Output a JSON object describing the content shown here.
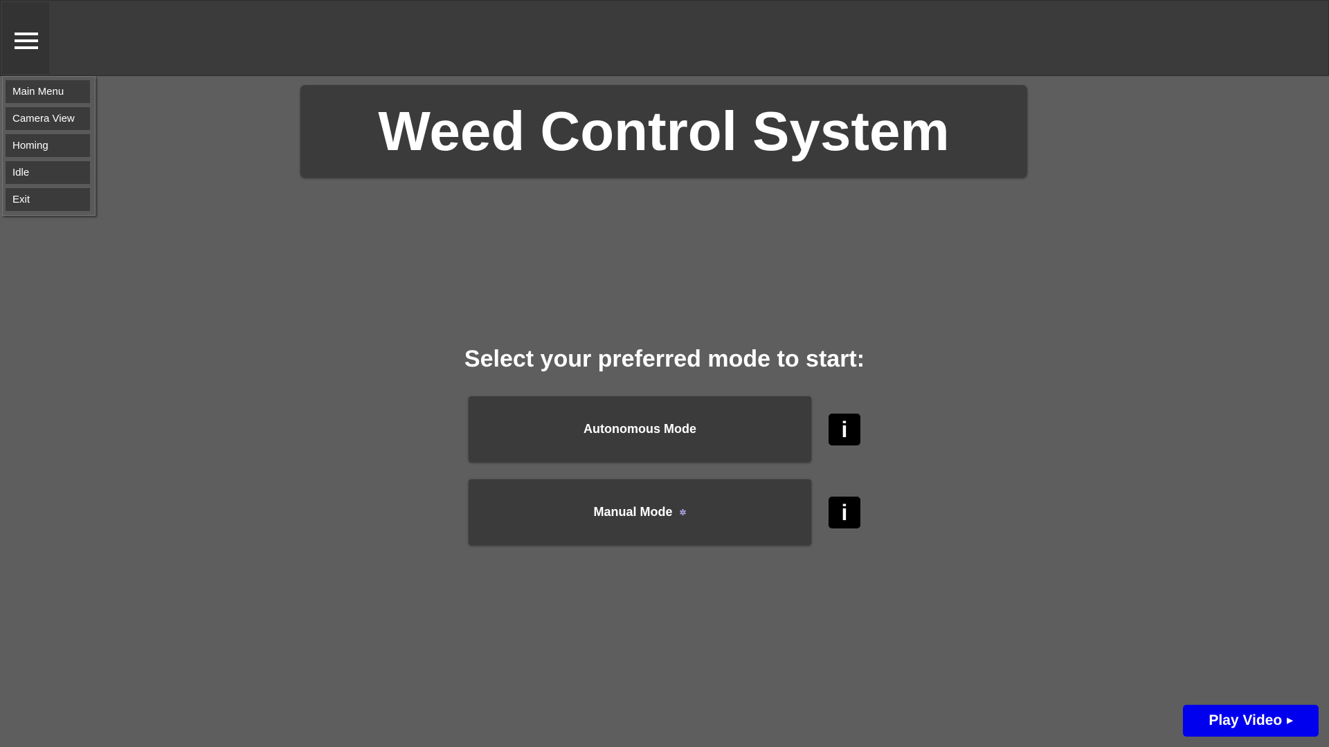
{
  "header": {
    "menu_icon": "hamburger-menu-icon"
  },
  "menu": {
    "items": [
      {
        "label": "Main Menu"
      },
      {
        "label": "Camera View"
      },
      {
        "label": "Homing"
      },
      {
        "label": "Idle"
      },
      {
        "label": "Exit"
      }
    ]
  },
  "main": {
    "title": "Weed Control System",
    "prompt": "Select your preferred mode to start:",
    "modes": [
      {
        "label": "Autonomous Mode",
        "info_label": "i"
      },
      {
        "label": "Manual Mode",
        "info_label": "i",
        "icon": "sparkle-icon"
      }
    ]
  },
  "video": {
    "label": "Play Video",
    "icon": "play-triangle-icon"
  },
  "colors": {
    "background": "#5e5e5e",
    "panel": "#3b3b3b",
    "info_button": "#000000",
    "play_button": "#0000ee",
    "sparkle": "#b9a4ee"
  }
}
